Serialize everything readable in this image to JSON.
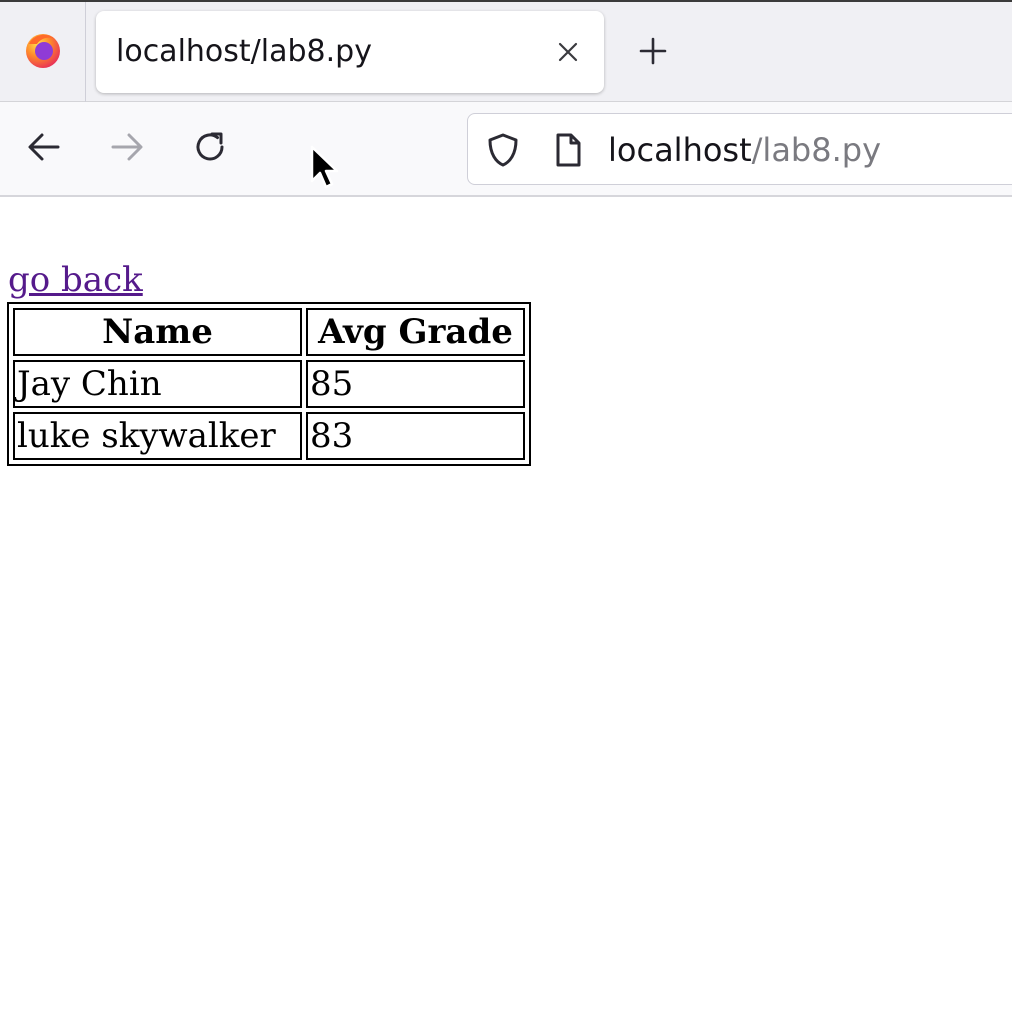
{
  "browser": {
    "tab": {
      "title": "localhost/lab8.py",
      "close_icon": "close-icon"
    },
    "new_tab_icon": "plus-icon",
    "nav": {
      "back_icon": "arrow-left-icon",
      "forward_icon": "arrow-right-icon",
      "reload_icon": "reload-icon"
    },
    "urlbar": {
      "host": "localhost",
      "path": "/lab8.py",
      "shield_icon": "shield-icon",
      "page_icon": "page-icon"
    },
    "colors": {
      "link_visited": "#551a8b",
      "chrome_bg": "#f0f0f4"
    }
  },
  "page": {
    "back_link": "go back",
    "table": {
      "headers": [
        "Name",
        "Avg Grade"
      ],
      "rows": [
        [
          "Jay Chin",
          "85"
        ],
        [
          "luke skywalker",
          "83"
        ]
      ]
    }
  }
}
